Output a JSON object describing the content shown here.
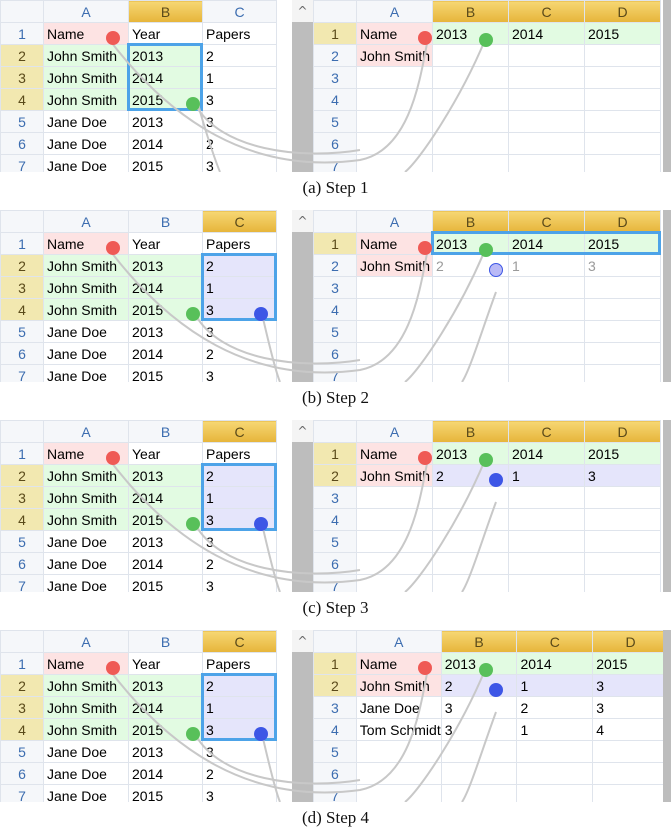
{
  "left_sheet": {
    "columns": [
      "A",
      "B",
      "C"
    ],
    "rows": [
      [
        "1",
        "Name",
        "Year",
        "Papers"
      ],
      [
        "2",
        "John Smith",
        "2013",
        "2"
      ],
      [
        "3",
        "John Smith",
        "2014",
        "1"
      ],
      [
        "4",
        "John Smith",
        "2015",
        "3"
      ],
      [
        "5",
        "Jane Doe",
        "2013",
        "3"
      ],
      [
        "6",
        "Jane Doe",
        "2014",
        "2"
      ],
      [
        "7",
        "Jane Doe",
        "2015",
        "3"
      ]
    ]
  },
  "right_sheet": {
    "columns": [
      "A",
      "B",
      "C",
      "D"
    ],
    "row_numbers": [
      "1",
      "2",
      "3",
      "4",
      "5",
      "6",
      "7"
    ]
  },
  "scroll_up_glyph": "^",
  "colors": {
    "name_highlight": "#fde3e3",
    "year_highlight": "#e2fbe2",
    "papers_highlight": "#e5e5fb",
    "selection_border": "#4da3e8",
    "column_header_active": "#e6b43a"
  },
  "panels": [
    {
      "caption": "(a) Step 1",
      "right_rows": [
        [
          "Name",
          "2013",
          "2014",
          "2015"
        ],
        [
          "John Smith",
          "",
          "",
          ""
        ],
        [
          "",
          "",
          "",
          ""
        ],
        [
          "",
          "",
          "",
          ""
        ],
        [
          "",
          "",
          "",
          ""
        ],
        [
          "",
          "",
          "",
          ""
        ],
        [
          "",
          "",
          "",
          ""
        ]
      ]
    },
    {
      "caption": "(b) Step 2",
      "right_rows": [
        [
          "Name",
          "2013",
          "2014",
          "2015"
        ],
        [
          "John Smith",
          "2",
          "1",
          "3"
        ],
        [
          "",
          "",
          "",
          ""
        ],
        [
          "",
          "",
          "",
          ""
        ],
        [
          "",
          "",
          "",
          ""
        ],
        [
          "",
          "",
          "",
          ""
        ],
        [
          "",
          "",
          "",
          ""
        ]
      ]
    },
    {
      "caption": "(c) Step 3",
      "right_rows": [
        [
          "Name",
          "2013",
          "2014",
          "2015"
        ],
        [
          "John Smith",
          "2",
          "1",
          "3"
        ],
        [
          "",
          "",
          "",
          ""
        ],
        [
          "",
          "",
          "",
          ""
        ],
        [
          "",
          "",
          "",
          ""
        ],
        [
          "",
          "",
          "",
          ""
        ],
        [
          "",
          "",
          "",
          ""
        ]
      ]
    },
    {
      "caption": "(d) Step 4",
      "right_rows": [
        [
          "Name",
          "2013",
          "2014",
          "2015"
        ],
        [
          "John Smith",
          "2",
          "1",
          "3"
        ],
        [
          "Jane Doe",
          "3",
          "2",
          "3"
        ],
        [
          "Tom Schmidt",
          "3",
          "1",
          "4"
        ],
        [
          "",
          "",
          "",
          ""
        ],
        [
          "",
          "",
          "",
          ""
        ],
        [
          "",
          "",
          "",
          ""
        ]
      ]
    }
  ]
}
